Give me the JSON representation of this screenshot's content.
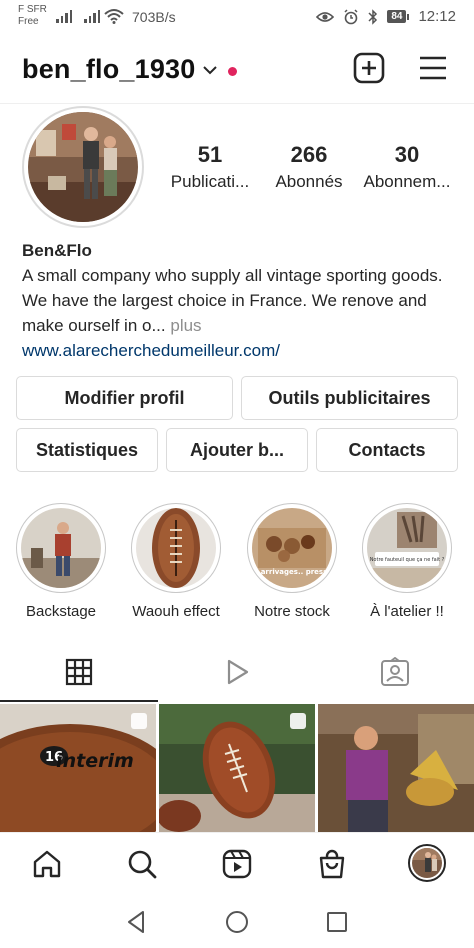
{
  "status_bar": {
    "carrier_line1": "F SFR",
    "carrier_line2": "Free",
    "speed": "703B/s",
    "battery": "84",
    "time": "12:12",
    "icons": [
      "signal-icon",
      "wifi-icon",
      "eye-icon",
      "alarm-icon",
      "bluetooth-icon",
      "battery-icon"
    ]
  },
  "header": {
    "username": "ben_flo_1930",
    "icons": [
      "chevron-down-icon",
      "notification-dot",
      "new-post-icon",
      "menu-icon"
    ]
  },
  "profile": {
    "stats": [
      {
        "value": "51",
        "label": "Publicati..."
      },
      {
        "value": "266",
        "label": "Abonnés"
      },
      {
        "value": "30",
        "label": "Abonnem..."
      }
    ],
    "name": "Ben&Flo",
    "bio": "A small company who supply all vintage sporting goods. We have the largest choice in France. We renove and make ourself in o...",
    "more": "plus",
    "link": "www.alarecherchedumeilleur.com/"
  },
  "buttons": {
    "edit_profile": "Modifier profil",
    "ad_tools": "Outils publicitaires",
    "insights": "Statistiques",
    "add_shop": "Ajouter b...",
    "contacts": "Contacts"
  },
  "highlights": [
    {
      "label": "Backstage"
    },
    {
      "label": "Waouh effect"
    },
    {
      "label": "Notre stock"
    },
    {
      "label": "À l'atelier !!"
    }
  ],
  "highlight_overlay_text": {
    "stock": "...ils arrivages.. pressés ?",
    "atelier": "Notre fauteuil que ça ne fait ?"
  },
  "grid_posts": [
    {
      "text": "16 interim"
    },
    {
      "text": ""
    },
    {
      "text": ""
    }
  ],
  "tabs": [
    "grid-icon",
    "reels-icon",
    "tagged-icon"
  ],
  "bottom_nav": [
    "home-icon",
    "search-icon",
    "reels-icon",
    "shop-icon",
    "profile-avatar"
  ],
  "colors": {
    "link": "#00376b",
    "notification": "#e0245e",
    "text": "#262626",
    "muted": "#8e8e8e"
  }
}
